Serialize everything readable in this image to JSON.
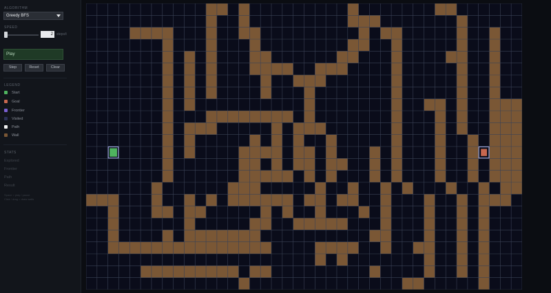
{
  "sidebar": {
    "algorithm_label": "ALGORITHM",
    "algorithm_value": "Greedy BFS",
    "speed_label": "SPEED",
    "speed_value": "2",
    "speed_unit": "steps/t",
    "play_label": "Play",
    "step_label": "Step",
    "reset_label": "Reset",
    "clear_label": "Clear",
    "legend_label": "LEGEND",
    "legend": [
      {
        "label": "Start",
        "color": "#4fb35f"
      },
      {
        "label": "Goal",
        "color": "#c7674f"
      },
      {
        "label": "Frontier",
        "color": "#7a5fd1"
      },
      {
        "label": "Visited",
        "color": "#2b3157"
      },
      {
        "label": "Path",
        "color": "#f2f2f2"
      },
      {
        "label": "Wall",
        "color": "#7a5735"
      }
    ],
    "stats_label": "STATS",
    "stats": [
      "Explored",
      "Frontier",
      "Path",
      "Result"
    ],
    "hint_lines": [
      "Space = play / pause",
      "Click / drag = draw walls"
    ]
  },
  "grid": {
    "cols": 40,
    "rows": 24,
    "background": "#0a0c1a",
    "line_color": "#3b4256",
    "wall_color": "#7a5735",
    "start": {
      "col": 2,
      "row": 12,
      "color": "#4fb35f"
    },
    "goal": {
      "col": 36,
      "row": 12,
      "color": "#c7674f"
    },
    "walls": [
      "...........XX.X.........X.......XX......",
      "...........X..X.........XXX.......X.....",
      "....XXXX...X..XX.........X.XX.....X..X..",
      ".......X...X...X........XX..X.....X..X..",
      ".......X.X.X...XX......XX...X....XX..X..",
      ".......X.X.X...XXXX..XXX....X.....X..X..",
      ".......X.X.X....X..XXX......X.....X..X..",
      ".......X.X.X....X...X.......X.....X..X..",
      ".......X.X..........X.......X..XX.X..XXX",
      ".......X...XXXXXXXX.X.......X...X.X..XXX",
      ".......X.XXX.....X.XXX......X...X.X..XXX",
      ".......X.X.....X.X.X..X.....X...X..X.XXX",
      ".......X.X....XXXX.XX.X...X.X...X..X.XXX",
      ".......X......XX.X.XX.XX..X.X...X..X.XXX",
      ".......X......XXXXX.X.X...X.X...X..X.XXX",
      "......X......XXX.....X..X..X.X...X..X.XXX",
      "XXX...X..X.X.XXXXXX.XX.XX..X...X..X.XXX.",
      "..X...XX.XX.....X.X..X...X.X...X..X.X...",
      "..X......X.....XX..XXXXX...X...X..X.X...",
      "..X....X.XXXXXXX..........XX...X..X.X...",
      "..XXXXXXXXXXXXXXX....XXXX..X..XX..X.X...",
      ".....................X.X.......X..X.X...",
      ".....XXXXXXXXX.XX.........X....X..X.X...",
      "..............X..............XX.....X..."
    ]
  }
}
